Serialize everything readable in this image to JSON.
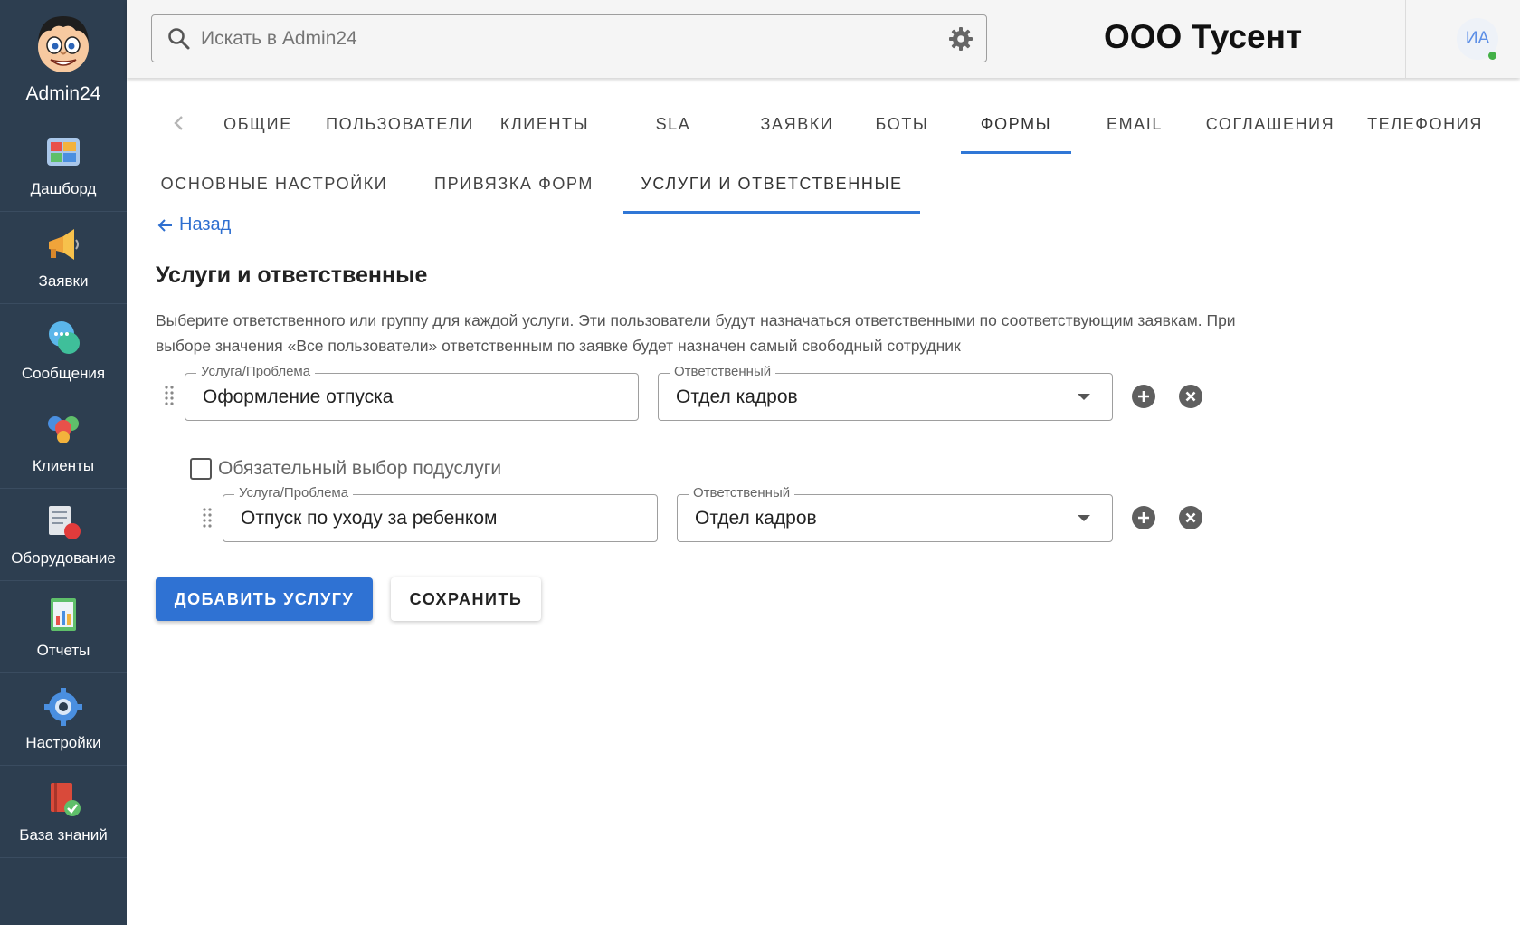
{
  "brand": {
    "name": "Admin24"
  },
  "sidebar": {
    "items": [
      {
        "label": "Дашборд",
        "icon": "dashboard-icon"
      },
      {
        "label": "Заявки",
        "icon": "megaphone-icon"
      },
      {
        "label": "Сообщения",
        "icon": "chat-bubbles-icon"
      },
      {
        "label": "Клиенты",
        "icon": "clients-icon"
      },
      {
        "label": "Оборудование",
        "icon": "equipment-icon"
      },
      {
        "label": "Отчеты",
        "icon": "reports-icon"
      },
      {
        "label": "Настройки",
        "icon": "gear-icon"
      },
      {
        "label": "База знаний",
        "icon": "knowledge-base-icon"
      }
    ]
  },
  "header": {
    "search_placeholder": "Искать в Admin24",
    "company": "ООО Тусент",
    "avatar_initials": "ИА",
    "status_color": "#43b047"
  },
  "tabs": [
    {
      "label": "Общие"
    },
    {
      "label": "Пользователи"
    },
    {
      "label": "Клиенты"
    },
    {
      "label": "SLA"
    },
    {
      "label": "Заявки"
    },
    {
      "label": "Боты"
    },
    {
      "label": "Формы",
      "active": true
    },
    {
      "label": "Email"
    },
    {
      "label": "Соглашения"
    },
    {
      "label": "Телефония"
    }
  ],
  "subtabs": [
    {
      "label": "Основные настройки"
    },
    {
      "label": "Привязка форм"
    },
    {
      "label": "Услуги и ответственные",
      "active": true
    }
  ],
  "content": {
    "back_label": "Назад",
    "title": "Услуги и ответственные",
    "description": "Выберите ответственного или группу для каждой услуги. Эти пользователи будут назначаться ответственными по соответствующим заявкам. При выборе значения «Все пользователи» ответственным по заявке будет назначен самый свободный сотрудник",
    "service_label": "Услуга/Проблема",
    "responsible_label": "Ответственный",
    "rows": [
      {
        "service": "Оформление отпуска",
        "responsible": "Отдел кадров"
      }
    ],
    "subservice_checkbox": "Обязательный выбор подуслуги",
    "subrows": [
      {
        "service": "Отпуск по уходу за ребенком",
        "responsible": "Отдел кадров"
      }
    ],
    "add_button": "ДОБАВИТЬ УСЛУГУ",
    "save_button": "СОХРАНИТЬ"
  },
  "colors": {
    "sidebar": "#2d3e50",
    "accent": "#2f72d3"
  }
}
